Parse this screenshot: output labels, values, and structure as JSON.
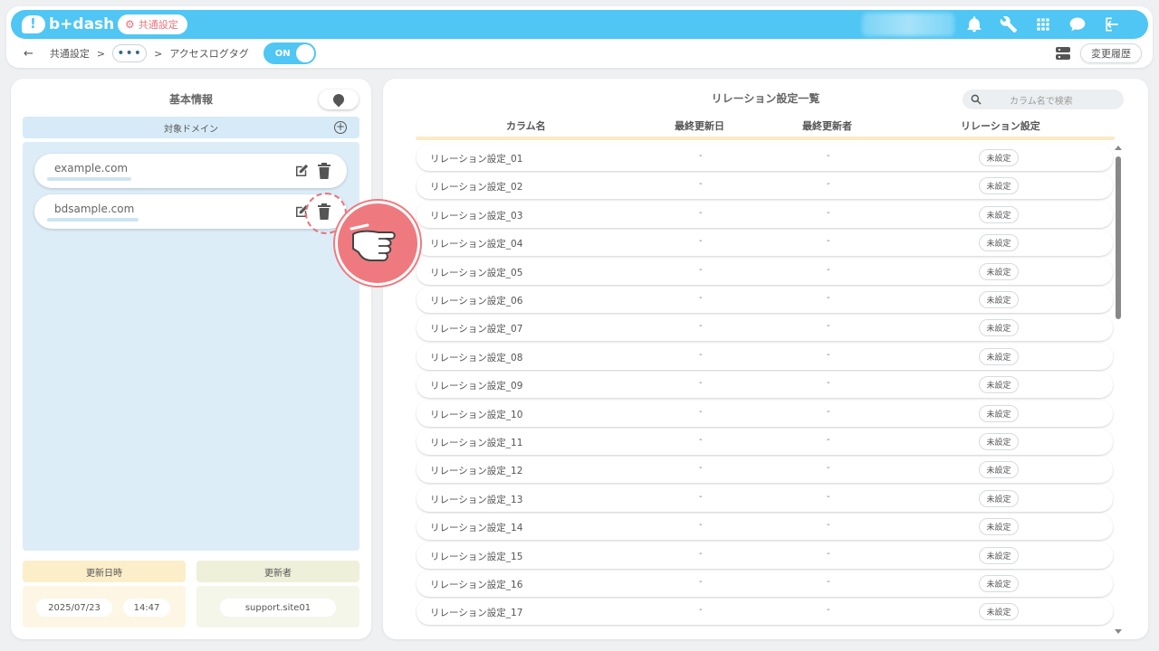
{
  "app": {
    "logo": "b+dash",
    "tag": "共通設定"
  },
  "breadcrumb": {
    "back": "←",
    "root": "共通設定",
    "sep1": ">",
    "more": "•••",
    "sep2": ">",
    "current": "アクセスログタグ",
    "toggle": "ON"
  },
  "header": {
    "history_button": "変更履歴"
  },
  "left": {
    "title": "基本情報",
    "domain_header": "対象ドメイン",
    "domains": [
      {
        "name": "example.com"
      },
      {
        "name": "bdsample.com"
      }
    ],
    "updated_at_label": "更新日時",
    "updated_by_label": "更新者",
    "updated_date": "2025/07/23",
    "updated_time": "14:47",
    "updated_by": "support.site01"
  },
  "right": {
    "title": "リレーション設定一覧",
    "search_placeholder": "カラム名で検索",
    "columns": {
      "name": "カラム名",
      "date": "最終更新日",
      "user": "最終更新者",
      "setting": "リレーション設定"
    },
    "rows": [
      {
        "name": "リレーション設定_01",
        "date": "-",
        "user": "-",
        "status": "未設定"
      },
      {
        "name": "リレーション設定_02",
        "date": "-",
        "user": "-",
        "status": "未設定"
      },
      {
        "name": "リレーション設定_03",
        "date": "-",
        "user": "-",
        "status": "未設定"
      },
      {
        "name": "リレーション設定_04",
        "date": "-",
        "user": "-",
        "status": "未設定"
      },
      {
        "name": "リレーション設定_05",
        "date": "-",
        "user": "-",
        "status": "未設定"
      },
      {
        "name": "リレーション設定_06",
        "date": "-",
        "user": "-",
        "status": "未設定"
      },
      {
        "name": "リレーション設定_07",
        "date": "-",
        "user": "-",
        "status": "未設定"
      },
      {
        "name": "リレーション設定_08",
        "date": "-",
        "user": "-",
        "status": "未設定"
      },
      {
        "name": "リレーション設定_09",
        "date": "-",
        "user": "-",
        "status": "未設定"
      },
      {
        "name": "リレーション設定_10",
        "date": "-",
        "user": "-",
        "status": "未設定"
      },
      {
        "name": "リレーション設定_11",
        "date": "-",
        "user": "-",
        "status": "未設定"
      },
      {
        "name": "リレーション設定_12",
        "date": "-",
        "user": "-",
        "status": "未設定"
      },
      {
        "name": "リレーション設定_13",
        "date": "-",
        "user": "-",
        "status": "未設定"
      },
      {
        "name": "リレーション設定_14",
        "date": "-",
        "user": "-",
        "status": "未設定"
      },
      {
        "name": "リレーション設定_15",
        "date": "-",
        "user": "-",
        "status": "未設定"
      },
      {
        "name": "リレーション設定_16",
        "date": "-",
        "user": "-",
        "status": "未設定"
      },
      {
        "name": "リレーション設定_17",
        "date": "-",
        "user": "-",
        "status": "未設定"
      }
    ]
  },
  "colors": {
    "brand": "#4fc6f4",
    "accent_red": "#ee7a7f",
    "domain_bg": "#dcedf8",
    "date_bg": "#fbeec9",
    "user_bg": "#eef0d9"
  }
}
